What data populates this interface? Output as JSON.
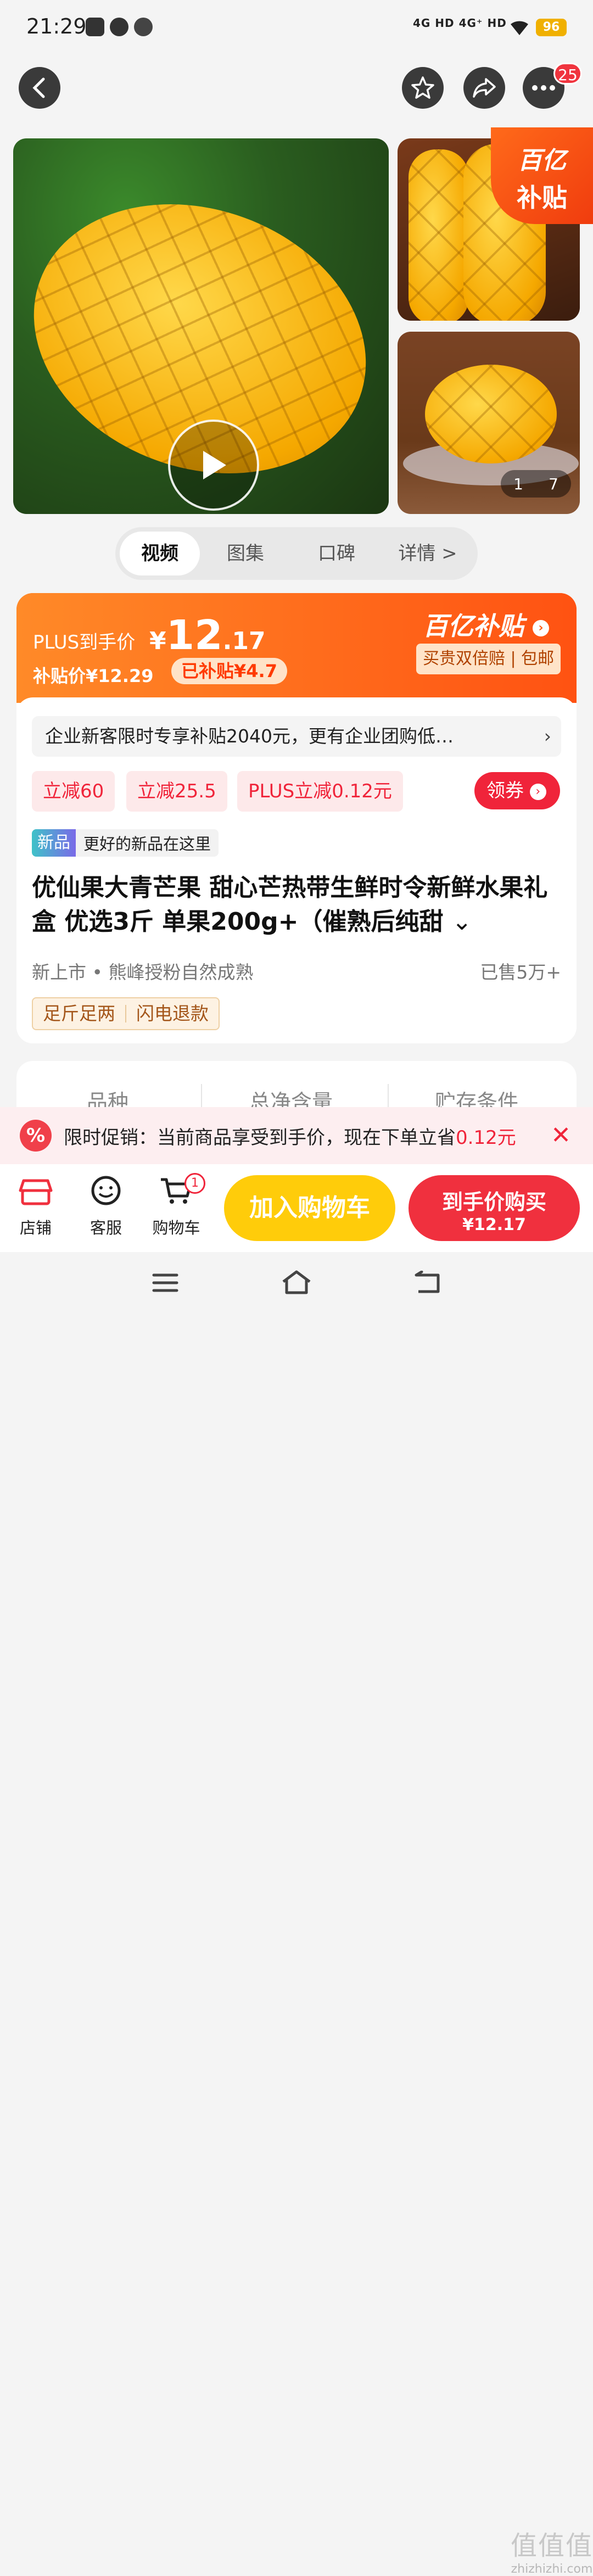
{
  "status": {
    "time": "21:29",
    "signal": "4G HD 4G⁺ HD",
    "battery": "96"
  },
  "header": {
    "message_count": "25"
  },
  "gallery": {
    "index": "1",
    "total": "7",
    "corner_line1": "百亿",
    "corner_line2": "补贴"
  },
  "tabs": [
    "视频",
    "图集",
    "口碑",
    "详情 >"
  ],
  "price": {
    "plus_label": "PLUS到手价",
    "currency": "¥",
    "int": "12",
    "dec": ".17",
    "subsidy_price": "补贴价¥12.29",
    "subsidized": "已补贴¥4.7",
    "badge": "百亿补贴",
    "guarantee": "买贵双倍赔 | 包邮"
  },
  "promo": {
    "text": "企业新客限时专享补贴2040元，更有企业团购低…",
    "arrow": "›"
  },
  "coupons": [
    "立减60",
    "立减25.5",
    "PLUS立减0.12元"
  ],
  "get_coupon": "领券",
  "new_tag": {
    "badge": "新品",
    "text": "更好的新品在这里"
  },
  "title": "优仙果大青芒果 甜心芒热带生鲜时令新鲜水果礼盒 优选3斤 单果200g+（催熟后纯甜",
  "meta": "新上市 • 熊峰授粉自然成熟",
  "sold": "已售5万+",
  "guarantee_tags": [
    "足斤足两",
    "闪电退款"
  ],
  "specs": [
    "品种",
    "总净含量",
    "贮存条件"
  ],
  "banner": {
    "text": "限时促销：当前商品享受到手价，现在下单立省",
    "highlight": "0.12元",
    "close": "✕",
    "icon": "%"
  },
  "bottom": {
    "shop": "店铺",
    "service": "客服",
    "cart": "购物车",
    "cart_count": "1",
    "add_cart": "加入购物车",
    "buy_label": "到手价购买",
    "buy_price": "¥12.17"
  },
  "watermark": {
    "big": "值值值",
    "small": "zhizhizhi.com"
  },
  "colors": {
    "accent": "#ff5a12",
    "red": "#f0243a",
    "yellow": "#ffcc0a"
  }
}
